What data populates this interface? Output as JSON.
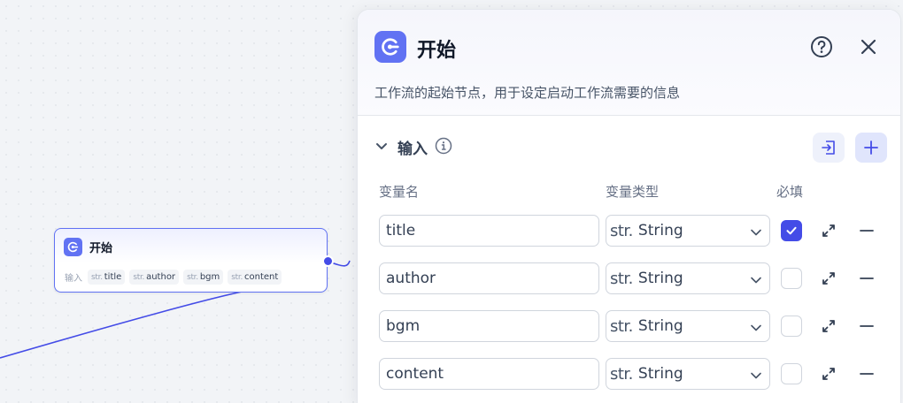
{
  "node": {
    "title": "开始",
    "inputs_label": "输入",
    "chips": [
      {
        "type": "str.",
        "name": "title"
      },
      {
        "type": "str.",
        "name": "author"
      },
      {
        "type": "str.",
        "name": "bgm"
      },
      {
        "type": "str.",
        "name": "content"
      }
    ]
  },
  "panel": {
    "title": "开始",
    "description": "工作流的起始节点，用于设定启动工作流需要的信息",
    "section_title": "输入",
    "columns": {
      "name": "变量名",
      "type": "变量类型",
      "required": "必填"
    },
    "rows": [
      {
        "name": "title",
        "type_prefix": "str.",
        "type": "String",
        "required": true
      },
      {
        "name": "author",
        "type_prefix": "str.",
        "type": "String",
        "required": false
      },
      {
        "name": "bgm",
        "type_prefix": "str.",
        "type": "String",
        "required": false
      },
      {
        "name": "content",
        "type_prefix": "str.",
        "type": "String",
        "required": false
      }
    ]
  },
  "colors": {
    "accent": "#444ce7",
    "icon_bg": "#6172f3"
  },
  "icons": [
    "start-node-icon",
    "help-icon",
    "close-icon",
    "chevron-down-icon",
    "info-icon",
    "import-icon",
    "plus-icon",
    "expand-icon",
    "minus-icon",
    "check-icon"
  ]
}
